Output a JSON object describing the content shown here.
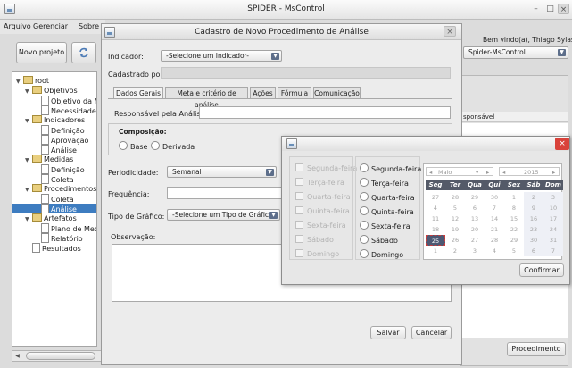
{
  "window": {
    "title": "SPIDER - MsControl",
    "controls": [
      "–",
      "□",
      "×"
    ]
  },
  "menu": [
    "Arquivo",
    "Gerenciar",
    "Sobre"
  ],
  "toolbar": {
    "new_project": "Novo projeto",
    "refresh_icon": "refresh-icon"
  },
  "welcome": "Bem vindo(a), Thiago Sylas",
  "project_combo": "Spider-MsControl",
  "right_column_header": "sponsável",
  "procedure_button": "Procedimento",
  "tree": [
    {
      "label": "root",
      "level": 0,
      "kind": "folder",
      "expanded": true
    },
    {
      "label": "Objetivos",
      "level": 1,
      "kind": "folder",
      "expanded": true
    },
    {
      "label": "Objetivo da Me",
      "level": 2,
      "kind": "doc"
    },
    {
      "label": "Necessidade",
      "level": 2,
      "kind": "doc"
    },
    {
      "label": "Indicadores",
      "level": 1,
      "kind": "folder",
      "expanded": true
    },
    {
      "label": "Definição",
      "level": 2,
      "kind": "doc"
    },
    {
      "label": "Aprovação",
      "level": 2,
      "kind": "doc"
    },
    {
      "label": "Análise",
      "level": 2,
      "kind": "doc"
    },
    {
      "label": "Medidas",
      "level": 1,
      "kind": "folder",
      "expanded": true
    },
    {
      "label": "Definição",
      "level": 2,
      "kind": "doc"
    },
    {
      "label": "Coleta",
      "level": 2,
      "kind": "doc"
    },
    {
      "label": "Procedimentos",
      "level": 1,
      "kind": "folder",
      "expanded": true
    },
    {
      "label": "Coleta",
      "level": 2,
      "kind": "doc"
    },
    {
      "label": "Análise",
      "level": 2,
      "kind": "doc",
      "selected": true
    },
    {
      "label": "Artefatos",
      "level": 1,
      "kind": "folder",
      "expanded": true
    },
    {
      "label": "Plano de Medi",
      "level": 2,
      "kind": "doc"
    },
    {
      "label": "Relatório",
      "level": 2,
      "kind": "doc"
    },
    {
      "label": "Resultados",
      "level": 1,
      "kind": "doc"
    }
  ],
  "dialog": {
    "title": "Cadastro de Novo Procedimento de Análise",
    "close": "×",
    "indicator_label": "Indicador:",
    "indicator_value": "-Selecione um Indicador-",
    "registered_by_label": "Cadastrado por:",
    "tabs": [
      "Dados Gerais",
      "Meta e critério de análise",
      "Ações",
      "Fórmula",
      "Comunicação"
    ],
    "active_tab": "Dados Gerais",
    "responsible_label": "Responsável pela Análise:",
    "composition_label": "Composição:",
    "composition_options": [
      "Base",
      "Derivada"
    ],
    "periodicity_label": "Periodicidade:",
    "periodicity_value": "Semanal",
    "frequency_label": "Frequência:",
    "graph_type_label": "Tipo de Gráfico:",
    "graph_type_value": "-Selecione um Tipo de Gráfico-",
    "observation_label": "Observação:",
    "save": "Salvar",
    "cancel": "Cancelar"
  },
  "date_popup": {
    "close": "×",
    "checkbox_days": [
      "Segunda-feira",
      "Terça-feira",
      "Quarta-feira",
      "Quinta-feira",
      "Sexta-feira",
      "Sábado",
      "Domingo"
    ],
    "radio_days": [
      "Segunda-feira",
      "Terça-feira",
      "Quarta-feira",
      "Quinta-feira",
      "Sexta-feira",
      "Sábado",
      "Domingo"
    ],
    "month": "Maio",
    "year": "2015",
    "weekdays": [
      "Seg",
      "Ter",
      "Qua",
      "Qui",
      "Sex",
      "Sáb",
      "Dom"
    ],
    "weeks": [
      [
        "27",
        "28",
        "29",
        "30",
        "1",
        "2",
        "3"
      ],
      [
        "4",
        "5",
        "6",
        "7",
        "8",
        "9",
        "10"
      ],
      [
        "11",
        "12",
        "13",
        "14",
        "15",
        "16",
        "17"
      ],
      [
        "18",
        "19",
        "20",
        "21",
        "22",
        "23",
        "24"
      ],
      [
        "25",
        "26",
        "27",
        "28",
        "29",
        "30",
        "31"
      ],
      [
        "1",
        "2",
        "3",
        "4",
        "5",
        "6",
        "7"
      ]
    ],
    "selected_day": "25",
    "confirm": "Confirmar"
  }
}
